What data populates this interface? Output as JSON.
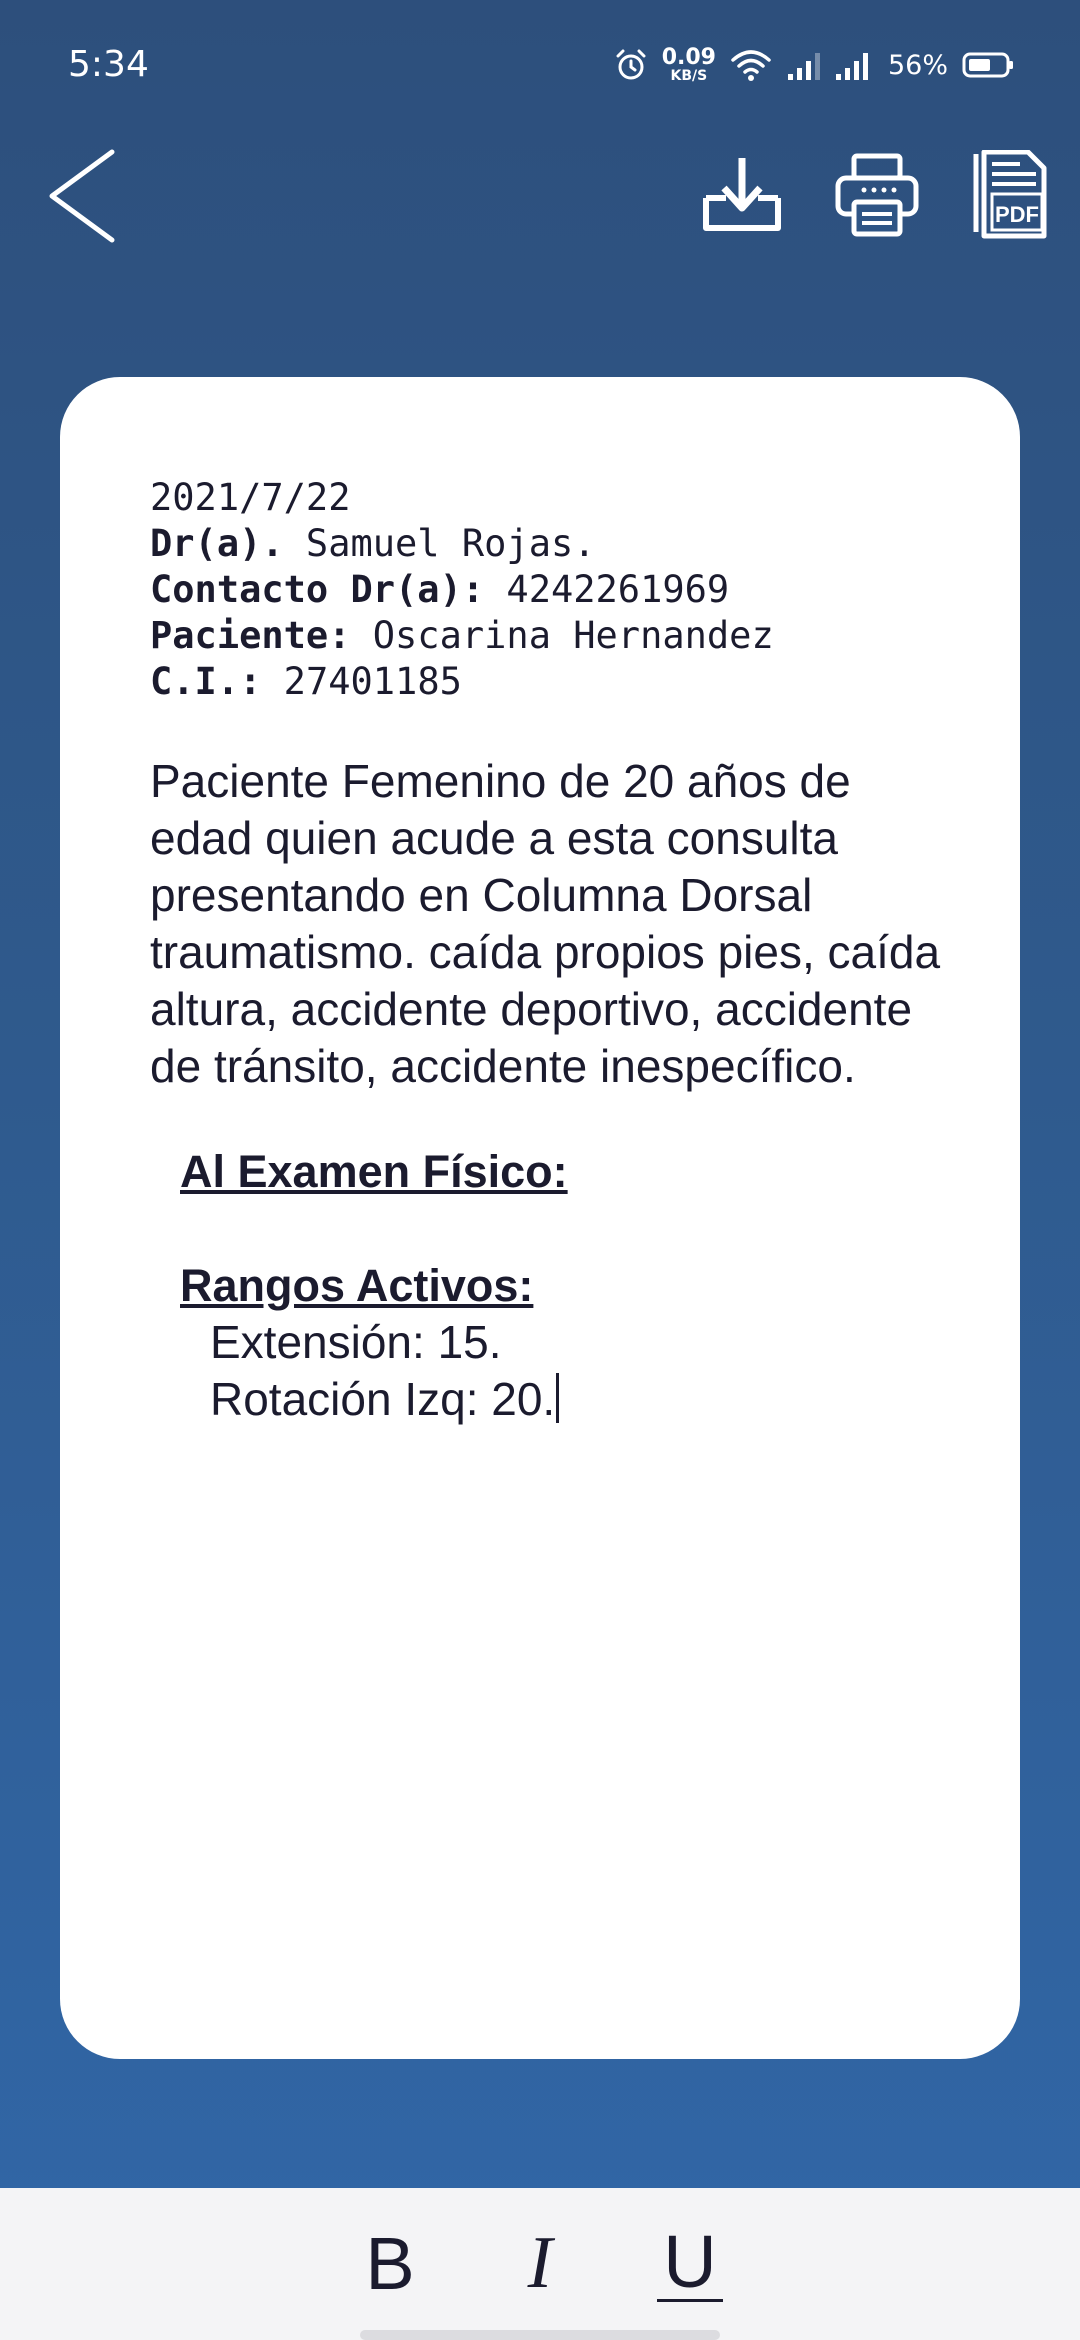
{
  "status_bar": {
    "time": "5:34",
    "net_speed_value": "0.09",
    "net_speed_unit": "KB/S",
    "battery": "56%",
    "icons": [
      "alarm-icon",
      "wifi-icon",
      "signal-icon",
      "signal-icon",
      "battery-icon"
    ]
  },
  "toolbar": {
    "back_icon": "back-arrow-icon",
    "actions": [
      "download-icon",
      "printer-icon",
      "pdf-icon"
    ]
  },
  "document": {
    "date": "2021/7/22",
    "doctor_label": "Dr(a).",
    "doctor_name": " Samuel Rojas.",
    "contact_label": "Contacto Dr(a):",
    "contact_value": " 4242261969",
    "patient_label": "Paciente:",
    "patient_value": " Oscarina Hernandez",
    "ci_label": "C.I.:",
    "ci_value": " 27401185",
    "body": "Paciente Femenino de 20 años de edad quien acude a esta consulta presentando en Columna Dorsal traumatismo. caída propios pies, caída altura, accidente deportivo, accidente de tránsito, accidente inespecífico.",
    "exam_heading": "Al Examen Físico:",
    "ranges_heading": "Rangos Activos:",
    "ranges": [
      "Extensión: 15.",
      "Rotación Izq: 20."
    ]
  },
  "format_bar": {
    "bold": "B",
    "italic": "I",
    "underline": "U"
  },
  "colors": {
    "background_top": "#2d4f7c",
    "background_bottom": "#3167a8",
    "card": "#ffffff",
    "text": "#1b1b2e"
  }
}
